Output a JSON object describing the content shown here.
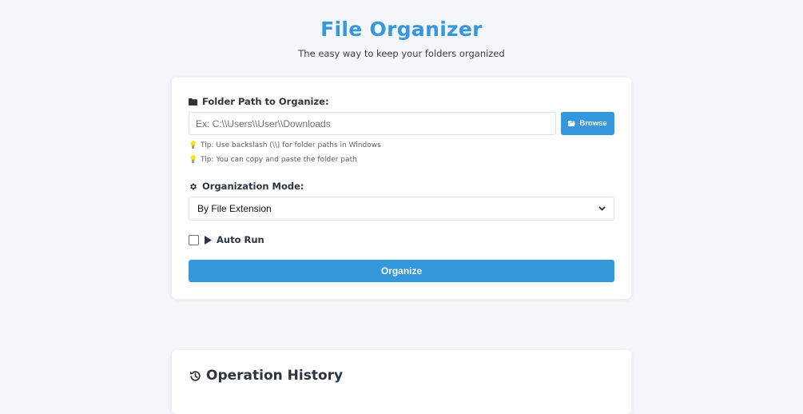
{
  "header": {
    "title": "File Organizer",
    "subtitle": "The easy way to keep your folders organized"
  },
  "folder": {
    "label": "Folder Path to Organize:",
    "icon": "folder-icon",
    "input_placeholder": "Ex: C:\\\\Users\\\\User\\\\Downloads",
    "input_value": "",
    "browse_label": "Browse",
    "browse_icon": "folder-open-icon"
  },
  "tips": [
    {
      "icon": "lightbulb-icon",
      "text": "Tip: Use backslash (\\\\) for folder paths in Windows"
    },
    {
      "icon": "lightbulb-icon",
      "text": "Tip: You can copy and paste the folder path"
    }
  ],
  "mode": {
    "label": "Organization Mode:",
    "icon": "gear-icon",
    "selected": "By File Extension"
  },
  "autorun": {
    "label": "Auto Run",
    "icon": "play-icon",
    "checked": false
  },
  "organize_label": "Organize",
  "history": {
    "title": "Operation History",
    "icon": "history-icon"
  },
  "colors": {
    "accent": "#3498db",
    "background": "#f5f6fa",
    "card": "#ffffff",
    "tip_icon": "#f1c40f"
  }
}
